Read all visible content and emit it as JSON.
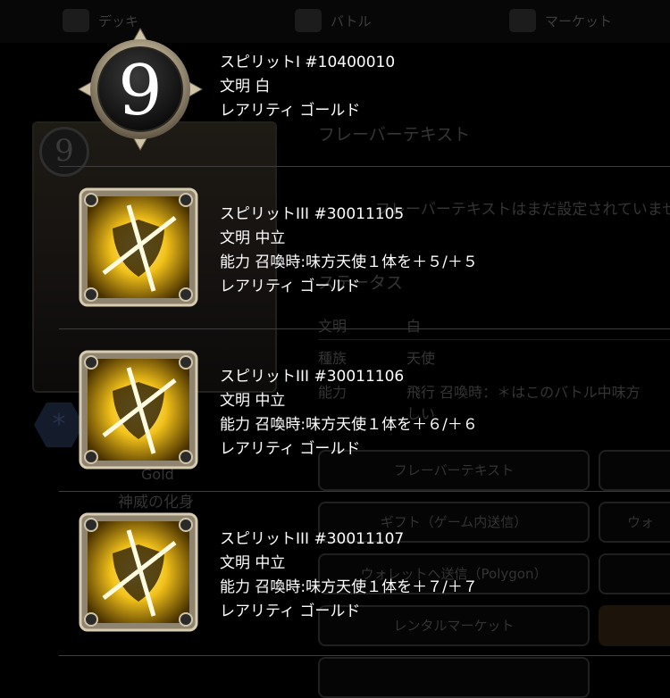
{
  "background": {
    "nav": [
      {
        "label": "デッキ"
      },
      {
        "label": "バトル"
      },
      {
        "label": "マーケット"
      }
    ],
    "card_cost": "9",
    "flavor_heading": "フレーバーテキスト",
    "flavor_text": "フレーバーテキストはまだ設定されていません",
    "status_heading": "ステータス",
    "stats": [
      {
        "key": "文明",
        "value": "白"
      },
      {
        "key": "種族",
        "value": "天使"
      },
      {
        "key": "能力",
        "value": "飛行 召喚時：＊はこのバトル中味方"
      }
    ],
    "stats_extra": "しい",
    "card_type_fragment": "Gold",
    "card_name": "神威の化身",
    "buttons": [
      "フレーバーテキスト",
      "ギフト（ゲーム内送信）",
      "ウォ",
      "ウォレットへ送信（Polygon）",
      "レンタルマーケット"
    ]
  },
  "spirits": [
    {
      "icon": "number-9-medallion-icon",
      "title": "スピリットI #10400010",
      "civ": "文明 白",
      "ability": "",
      "rarity": "レアリティ ゴールド"
    },
    {
      "icon": "crossed-shield-gold-icon",
      "title": "スピリットIII #30011105",
      "civ": "文明 中立",
      "ability": "能力 召喚時:味方天使１体を＋５/＋５",
      "rarity": "レアリティ ゴールド"
    },
    {
      "icon": "crossed-shield-gold-icon",
      "title": "スピリットIII #30011106",
      "civ": "文明 中立",
      "ability": "能力 召喚時:味方天使１体を＋６/＋６",
      "rarity": "レアリティ ゴールド"
    },
    {
      "icon": "crossed-shield-gold-icon",
      "title": "スピリットIII #30011107",
      "civ": "文明 中立",
      "ability": "能力 召喚時:味方天使１体を＋７/＋７",
      "rarity": "レアリティ ゴールド"
    }
  ],
  "colors": {
    "icon_gold": "#f2c11a",
    "frame": "#b8a98a",
    "divider": "#3c3c3c"
  }
}
